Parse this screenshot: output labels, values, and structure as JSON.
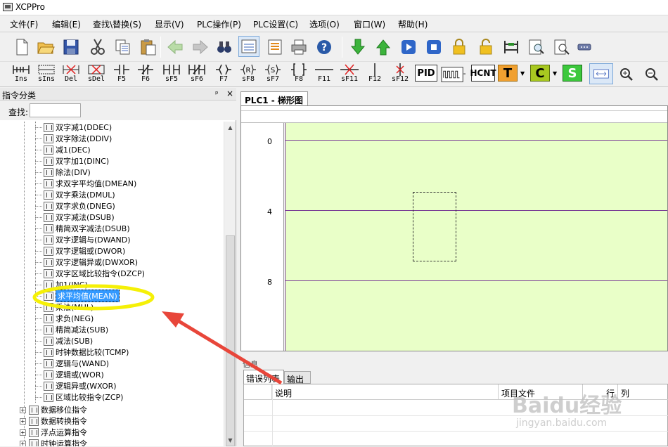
{
  "window": {
    "title": "XCPPro"
  },
  "menu": [
    "文件(F)",
    "编辑(E)",
    "查找\\替换(S)",
    "显示(V)",
    "PLC操作(P)",
    "PLC设置(C)",
    "选项(O)",
    "窗口(W)",
    "帮助(H)"
  ],
  "toolbar1": {
    "icons": [
      "new-file-icon",
      "open-folder-icon",
      "save-icon",
      "cut-icon",
      "copy-icon",
      "paste-icon",
      "back-arrow-icon",
      "forward-arrow-icon",
      "find-icon",
      "ladder-view-icon",
      "instruction-list-icon",
      "print-icon",
      "help-icon",
      "download-icon",
      "upload-icon",
      "run-icon",
      "stop-icon",
      "lock-icon",
      "unlock-icon",
      "monitor-icon",
      "preview-icon",
      "zoom-doc-icon",
      "serial-port-icon"
    ]
  },
  "toolbar2": {
    "buttons": [
      "Ins",
      "sIns",
      "Del",
      "sDel",
      "F5",
      "F6",
      "sF5",
      "sF6",
      "F7",
      "sF8",
      "sF7",
      "F8",
      "F11",
      "sF11",
      "F12",
      "sF12"
    ],
    "text_buttons": [
      "PID",
      "HCNT",
      "T",
      "C",
      "S"
    ]
  },
  "left_panel": {
    "title": "指令分类",
    "pin": "ᵖ",
    "close": "×",
    "search_label": "查找:",
    "search_value": "",
    "tree": [
      {
        "label": "双字减1(DDEC)",
        "icon": "instruction-icon"
      },
      {
        "label": "双字除法(DDIV)",
        "icon": "instruction-icon"
      },
      {
        "label": "减1(DEC)",
        "icon": "instruction-icon"
      },
      {
        "label": "双字加1(DINC)",
        "icon": "instruction-icon"
      },
      {
        "label": "除法(DIV)",
        "icon": "instruction-icon"
      },
      {
        "label": "求双字平均值(DMEAN)",
        "icon": "instruction-icon"
      },
      {
        "label": "双字乘法(DMUL)",
        "icon": "instruction-icon"
      },
      {
        "label": "双字求负(DNEG)",
        "icon": "instruction-icon"
      },
      {
        "label": "双字减法(DSUB)",
        "icon": "instruction-icon"
      },
      {
        "label": "精简双字减法(DSUB)",
        "icon": "instruction-icon"
      },
      {
        "label": "双字逻辑与(DWAND)",
        "icon": "instruction-icon"
      },
      {
        "label": "双字逻辑或(DWOR)",
        "icon": "instruction-icon"
      },
      {
        "label": "双字逻辑异或(DWXOR)",
        "icon": "instruction-icon"
      },
      {
        "label": "双字区域比较指令(DZCP)",
        "icon": "instruction-icon"
      },
      {
        "label": "加1(INC)",
        "icon": "instruction-icon"
      },
      {
        "label": "求平均值(MEAN)",
        "icon": "instruction-icon",
        "selected": true
      },
      {
        "label": "乘法(MUL)",
        "icon": "instruction-icon"
      },
      {
        "label": "求负(NEG)",
        "icon": "instruction-icon"
      },
      {
        "label": "精简减法(SUB)",
        "icon": "instruction-icon"
      },
      {
        "label": "减法(SUB)",
        "icon": "instruction-icon"
      },
      {
        "label": "时钟数据比较(TCMP)",
        "icon": "instruction-icon"
      },
      {
        "label": "逻辑与(WAND)",
        "icon": "instruction-icon"
      },
      {
        "label": "逻辑或(WOR)",
        "icon": "instruction-icon"
      },
      {
        "label": "逻辑异或(WXOR)",
        "icon": "instruction-icon"
      },
      {
        "label": "区域比较指令(ZCP)",
        "icon": "instruction-icon"
      }
    ],
    "categories": [
      {
        "label": "数据移位指令",
        "expander": "+"
      },
      {
        "label": "数据转换指令",
        "expander": "+"
      },
      {
        "label": "浮点运算指令",
        "expander": "+"
      },
      {
        "label": "时钟运算指令",
        "expander": "+"
      }
    ]
  },
  "document": {
    "tab": "PLC1 - 梯形图",
    "row_numbers": [
      "0",
      "4",
      "8"
    ]
  },
  "info_panel": {
    "title": "信息",
    "tabs": [
      "错误列表",
      "输出"
    ],
    "columns": [
      "说明",
      "项目文件",
      "行",
      "列"
    ]
  },
  "watermark": {
    "text": "Baidu经验",
    "url_text": "jingyan.baidu.com"
  },
  "annotation": {
    "highlight_color": "#f5f007",
    "arrow_color": "#e8463a"
  }
}
